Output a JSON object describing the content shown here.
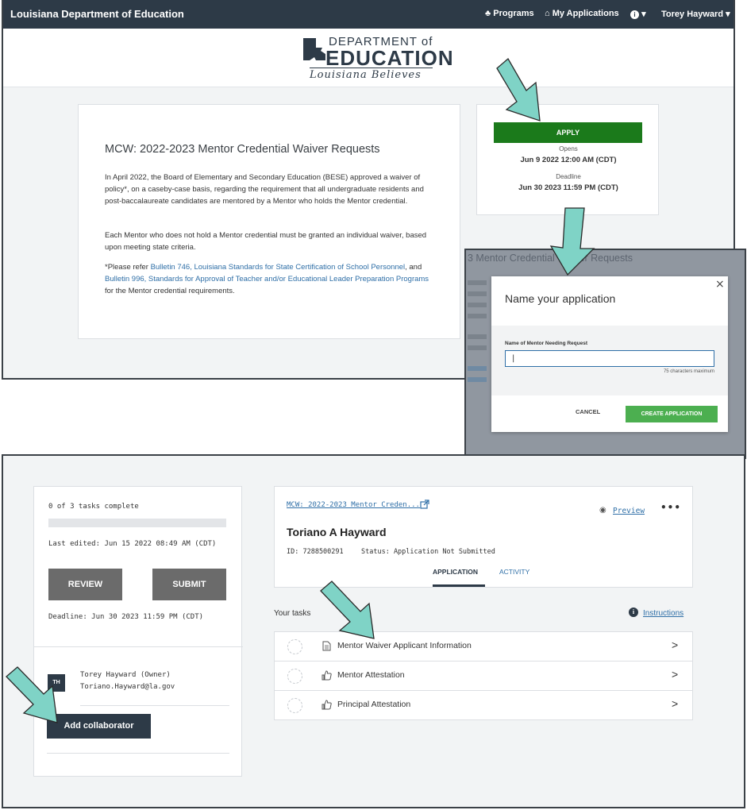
{
  "navbar": {
    "title": "Louisiana Department of Education",
    "programs": "Programs",
    "my_applications": "My Applications",
    "user": "Torey Hayward"
  },
  "logo": {
    "department": "DEPARTMENT of",
    "education": "EDUCATION",
    "tagline": "Louisiana Believes"
  },
  "program": {
    "title": "MCW: 2022-2023 Mentor Credential Waiver Requests",
    "para1": "In April 2022, the Board of Elementary and Secondary Education (BESE) approved a waiver of policy*, on a caseby-case basis, regarding the requirement that all undergraduate residents and post-baccalaureate candidates are mentored by a Mentor who holds the Mentor credential.",
    "para2": "Each Mentor who does not hold a Mentor credential must be granted an individual waiver, based upon meeting state criteria.",
    "para3_prefix": "*Please refer ",
    "para3_link1": "Bulletin 746, Louisiana Standards for State Certification of School Personnel",
    "para3_mid": ", and ",
    "para3_link2": "Bulletin 996, Standards for Approval of Teacher and/or Educational Leader Preparation Programs",
    "para3_suffix": " for the Mentor credential requirements."
  },
  "apply": {
    "button": "APPLY",
    "opens_label": "Opens",
    "opens_value": "Jun 9 2022 12:00 AM (CDT)",
    "deadline_label": "Deadline",
    "deadline_value": "Jun 30 2023 11:59 PM (CDT)"
  },
  "modal": {
    "background_title": "3 Mentor Credential Waiver Requests",
    "title": "Name your application",
    "close": "×",
    "field_label": "Name of Mentor Needing Request",
    "input_value": "",
    "hint": "75 characters maximum",
    "cancel": "CANCEL",
    "create": "CREATE APPLICATION"
  },
  "status_card": {
    "tasks_complete": "0 of 3 tasks complete",
    "progress_fraction": 0,
    "last_edited": "Last edited: Jun 15 2022 08:49 AM (CDT)",
    "review": "REVIEW",
    "submit": "SUBMIT",
    "deadline": "Deadline: Jun 30 2023 11:59 PM (CDT)",
    "avatar_initials": "TH",
    "owner_name": "Torey Hayward (Owner)",
    "owner_email": "Toriano.Hayward@la.gov",
    "add_collaborator": "Add collaborator"
  },
  "application": {
    "program_link": "MCW: 2022-2023 Mentor Creden...",
    "preview": "Preview",
    "more": "•••",
    "applicant": "Toriano A Hayward",
    "id": "ID: 7288500291",
    "status": "Status: Application Not Submitted",
    "tab_application": "APPLICATION",
    "tab_activity": "ACTIVITY"
  },
  "tasks": {
    "heading": "Your tasks",
    "instructions": "Instructions",
    "items": [
      {
        "label": "Mentor Waiver Applicant Information",
        "icon": "document-icon"
      },
      {
        "label": "Mentor Attestation",
        "icon": "thumbs-up-icon"
      },
      {
        "label": "Principal Attestation",
        "icon": "thumbs-up-icon"
      }
    ]
  },
  "colors": {
    "navbar": "#2d3a47",
    "apply_green": "#1b7a1b",
    "create_green": "#4caf50",
    "link_blue": "#2f6fa7",
    "arrow_teal": "#7fd3c6"
  }
}
